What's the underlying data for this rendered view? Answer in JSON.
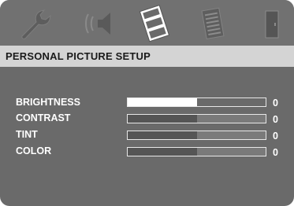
{
  "tabs": [
    {
      "icon": "wrench-icon"
    },
    {
      "icon": "speaker-icon"
    },
    {
      "icon": "film-icon",
      "active": true
    },
    {
      "icon": "document-icon"
    },
    {
      "icon": "door-exit-icon"
    }
  ],
  "menu": {
    "title": "PERSONAL PICTURE SETUP",
    "items": [
      {
        "label": "BRIGHTNESS",
        "value": "0",
        "level": 0.5,
        "selected": true
      },
      {
        "label": "CONTRAST",
        "value": "0",
        "level": 0.5,
        "selected": false
      },
      {
        "label": "TINT",
        "value": "0",
        "level": 0.5,
        "selected": false
      },
      {
        "label": "COLOR",
        "value": "0",
        "level": 0.5,
        "selected": false
      }
    ]
  },
  "colors": {
    "background": "#6a6a6a",
    "title_bar": "#d4d4d4",
    "text": "#ffffff",
    "bar_fill": "#555555",
    "bar_fill_selected": "#ffffff"
  }
}
